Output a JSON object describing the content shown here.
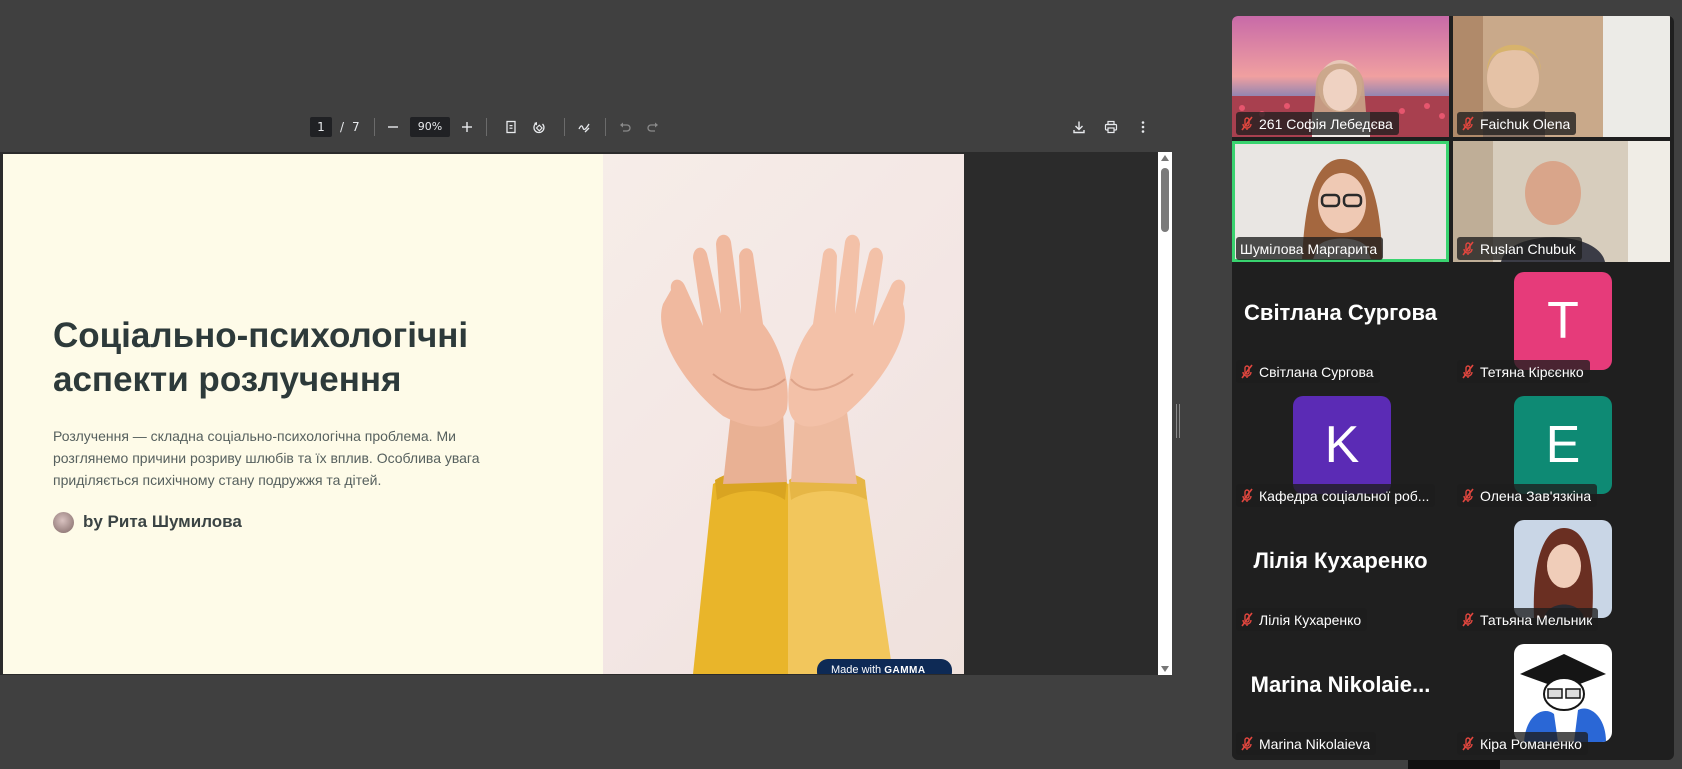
{
  "pdf_toolbar": {
    "current_page": "1",
    "page_separator": "/",
    "total_pages": "7",
    "zoom": "90%"
  },
  "slide": {
    "title": "Соціально-психологічні аспекти розлучення",
    "lead": "Розлучення — складна соціально-психологічна проблема. Ми розглянемо причини розриву шлюбів та їх вплив. Особлива увага приділяється психічному стану подружжя та дітей.",
    "byline": "by Рита Шумилова",
    "badge_prefix": "Made with",
    "badge_brand": "GAMMA"
  },
  "participants": [
    {
      "name": "261 Софія Лебедєва",
      "muted": true
    },
    {
      "name": "Faichuk Olena",
      "muted": true
    },
    {
      "name": "Шумілова Маргарита",
      "muted": false,
      "speaking": true
    },
    {
      "name": "Ruslan Chubuk",
      "muted": true
    },
    {
      "name": "Світлана Сургова",
      "display_name": "Світлана Сургова",
      "muted": true
    },
    {
      "name": "Тетяна Кірєєнко",
      "avatar_letter": "T",
      "avatar_color": "#e63b7a",
      "muted": true
    },
    {
      "name": "Кафедра соціальної роб...",
      "avatar_letter": "K",
      "avatar_color": "#5b2bb5",
      "muted": true
    },
    {
      "name": "Олена Зав'язкіна",
      "avatar_letter": "E",
      "avatar_color": "#0e8a74",
      "muted": true
    },
    {
      "name": "Лілія Кухаренко",
      "display_name": "Лілія Кухаренко",
      "muted": true
    },
    {
      "name": "Татьяна Мельник",
      "muted": true
    },
    {
      "name": "Marina Nikolaieva",
      "display_name": "Marina  Nikolaie...",
      "muted": true
    },
    {
      "name": "Кіра Романенко",
      "muted": true
    }
  ],
  "colors": {
    "speaking_outline": "#39d36f",
    "muted_icon": "#e0463e",
    "slide_bg": "#fefbe8"
  }
}
